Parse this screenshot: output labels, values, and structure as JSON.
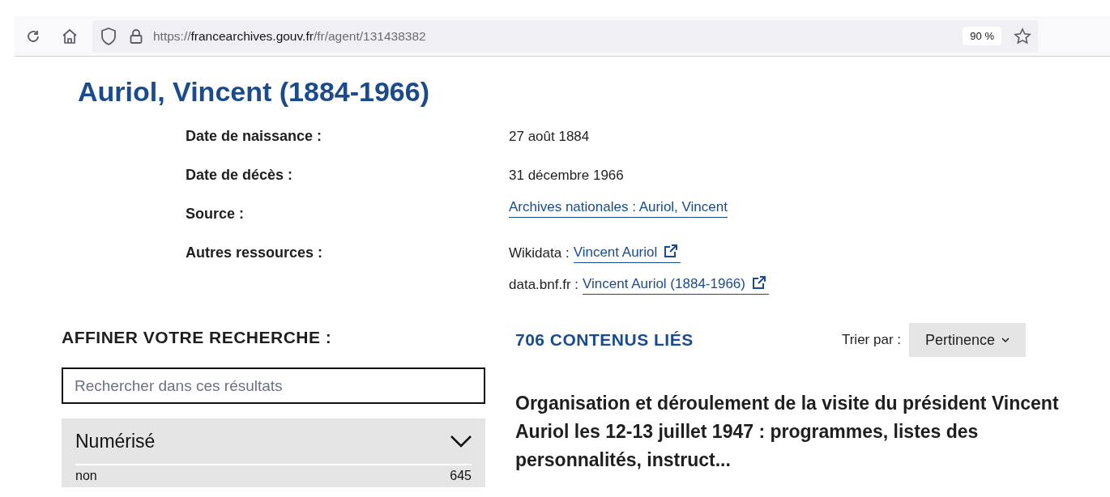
{
  "browser": {
    "url_scheme": "https://",
    "url_domain": "francearchives.gouv.fr",
    "url_path": "/fr/agent/131438382",
    "zoom": "90 %"
  },
  "title": "Auriol, Vincent (1884-1966)",
  "details": [
    {
      "label": "Date de naissance :",
      "lines": [
        {
          "value": "27 août 1884"
        }
      ]
    },
    {
      "label": "Date de décès :",
      "lines": [
        {
          "value": "31 décembre 1966"
        }
      ]
    },
    {
      "label": "Source :",
      "lines": [
        {
          "link": "Archives nationales : Auriol, Vincent",
          "external": false
        }
      ]
    },
    {
      "label": "Autres ressources :",
      "lines": [
        {
          "prefix": "Wikidata :",
          "link": "Vincent Auriol",
          "external": true
        },
        {
          "prefix": "data.bnf.fr :",
          "link": "Vincent Auriol (1884-1966)",
          "external": true
        }
      ]
    }
  ],
  "refine": {
    "heading": "AFFINER VOTRE RECHERCHE :",
    "search": {
      "placeholder": "Rechercher dans ces résultats"
    },
    "facet": {
      "title": "Numérisé",
      "expanded": true,
      "options": [
        {
          "label": "non",
          "count": "645"
        }
      ]
    }
  },
  "results": {
    "heading": "706 CONTENUS LIÉS",
    "sort_label": "Trier par :",
    "sort_value": "Pertinence",
    "items": [
      {
        "title": "Organisation et déroulement de la visite du président Vincent Auriol les 12-13 juillet 1947 : programmes, listes des personnalités, instruct..."
      }
    ]
  }
}
